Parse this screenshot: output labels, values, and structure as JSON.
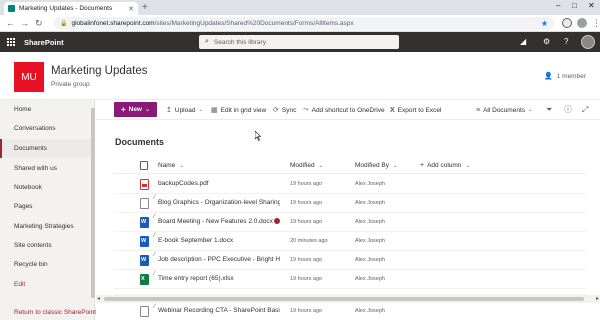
{
  "browser": {
    "tab_title": "Marketing Updates - Documents",
    "url_host": "globalinfonet.sharepoint.com",
    "url_path": "/sites/MarketingUpdates/Shared%20Documents/Forms/AllItems.aspx"
  },
  "suite": {
    "app_name": "SharePoint",
    "search_placeholder": "Search this library"
  },
  "site": {
    "logo_text": "MU",
    "title": "Marketing Updates",
    "subtitle": "Private group",
    "members": "1 member"
  },
  "nav": {
    "items": [
      {
        "label": "Home"
      },
      {
        "label": "Conversations"
      },
      {
        "label": "Documents"
      },
      {
        "label": "Shared with us"
      },
      {
        "label": "Notebook"
      },
      {
        "label": "Pages"
      },
      {
        "label": "Marketing Strategies"
      },
      {
        "label": "Site contents"
      },
      {
        "label": "Recycle bin"
      },
      {
        "label": "Edit"
      }
    ],
    "return_link": "Return to classic SharePoint"
  },
  "commands": {
    "new": "New",
    "upload": "Upload",
    "grid": "Edit in grid view",
    "sync": "Sync",
    "shortcut": "Add shortcut to OneDrive",
    "export": "Export to Excel",
    "view": "All Documents"
  },
  "library": {
    "title": "Documents",
    "columns": {
      "name": "Name",
      "modified": "Modified",
      "modified_by": "Modified By",
      "add_column": "Add column"
    },
    "rows": [
      {
        "name": "backupCodes.pdf",
        "type": "pdf",
        "modified": "19 hours ago",
        "by": "Alex Joseph"
      },
      {
        "name": "Blog Graphics - Organization-level Sharing ...",
        "type": "aspx",
        "modified": "19 hours ago",
        "by": "Alex Joseph"
      },
      {
        "name": "Board Meeting - New Features 2.0.docx",
        "type": "docx",
        "modified": "19 hours ago",
        "by": "Alex Joseph"
      },
      {
        "name": "E-book September 1.docx",
        "type": "docx",
        "modified": "20 minutes ago",
        "by": "Alex Joseph"
      },
      {
        "name": "Job description - PPC Executive - Bright Ho...",
        "type": "docx",
        "modified": "19 hours ago",
        "by": "Alex Joseph"
      },
      {
        "name": "Time entry report (65).xlsx",
        "type": "xlsx",
        "modified": "19 hours ago",
        "by": "Alex Joseph"
      },
      {
        "name": "Webinar Recording CTA - SharePoint Basics...",
        "type": "aspx",
        "modified": "19 hours ago",
        "by": "Alex Joseph"
      }
    ]
  },
  "colors": {
    "brand": "#8a1a75",
    "suite_bar": "#323130",
    "logo": "#e81123",
    "nav_accent": "#a4262c"
  }
}
